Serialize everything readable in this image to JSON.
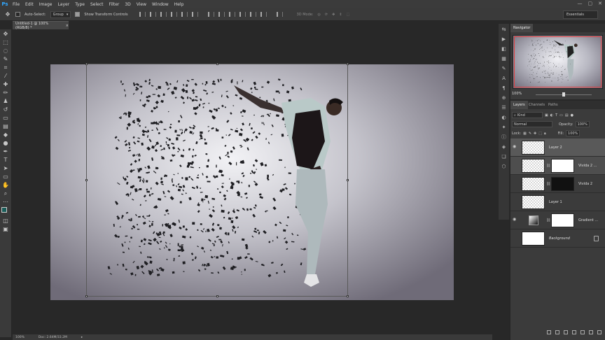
{
  "app": {
    "logo": "Ps"
  },
  "menu": [
    "File",
    "Edit",
    "Image",
    "Layer",
    "Type",
    "Select",
    "Filter",
    "3D",
    "View",
    "Window",
    "Help"
  ],
  "window_controls": {
    "minimize": "—",
    "maximize": "▢",
    "close": "✕"
  },
  "options_bar": {
    "auto_select_label": "Auto-Select:",
    "auto_select_checked": false,
    "auto_select_target": "Group",
    "show_transform_label": "Show Transform Controls",
    "show_transform_checked": true,
    "mode_3d_label": "3D Mode:",
    "workspace": "Essentials"
  },
  "document": {
    "tab_title": "Untitled-1 @ 100% (RGB/8) *",
    "close_glyph": "×"
  },
  "status": {
    "zoom": "100%",
    "doc_size": "Doc: 2.64M/33.2M"
  },
  "panels": {
    "navigator": {
      "tab": "Navigator",
      "zoom": "100%"
    },
    "layers": {
      "tabs": [
        "Layers",
        "Channels",
        "Paths"
      ],
      "filter_kind": "Kind",
      "blend_mode": "Normal",
      "opacity_label": "Opacity:",
      "opacity": "100%",
      "lock_label": "Lock:",
      "fill_label": "Fill:",
      "fill": "100%",
      "items": [
        {
          "name": "Layer 2",
          "visible": true,
          "selected": true,
          "has_mask": false
        },
        {
          "name": "Vivida 2 ...",
          "visible": false,
          "selected": true,
          "has_mask": true
        },
        {
          "name": "Vivida 2",
          "visible": false,
          "selected": false,
          "has_mask": true
        },
        {
          "name": "Layer 1",
          "visible": false,
          "selected": false,
          "has_mask": false
        },
        {
          "name": "Gradient ...",
          "visible": true,
          "selected": false,
          "has_mask": true
        },
        {
          "name": "Background",
          "visible": false,
          "selected": false,
          "has_mask": false,
          "locked": true
        }
      ]
    }
  },
  "colors": {
    "accent_blue": "#31a8ff",
    "nav_view_box": "#e03b3b",
    "panel_bg": "#3b3b3b"
  }
}
